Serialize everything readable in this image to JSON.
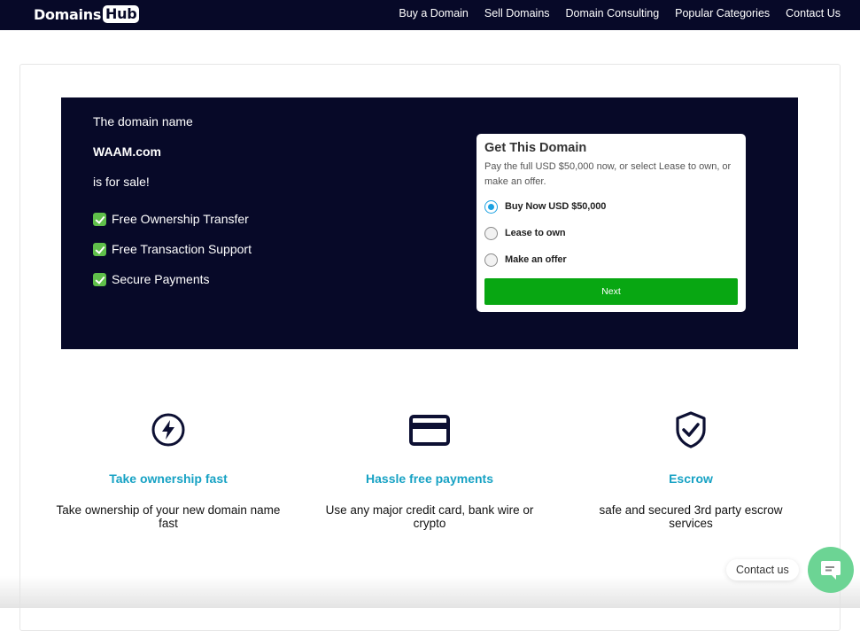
{
  "header": {
    "logo_main": "Domains",
    "logo_badge": "Hub",
    "nav": [
      "Buy a Domain",
      "Sell Domains",
      "Domain Consulting",
      "Popular Categories",
      "Contact Us"
    ]
  },
  "hero": {
    "intro": "The domain name",
    "domain": "WAAM.com",
    "status": "is for sale!",
    "features": [
      "Free Ownership Transfer",
      "Free Transaction Support",
      "Secure Payments"
    ]
  },
  "buy_box": {
    "title": "Get This Domain",
    "description": "Pay the full USD $50,000 now, or select Lease to own, or make an offer.",
    "options": [
      {
        "label": "Buy Now USD $50,000",
        "selected": true
      },
      {
        "label": "Lease to own",
        "selected": false
      },
      {
        "label": "Make an offer",
        "selected": false
      }
    ],
    "next_label": "Next"
  },
  "features": [
    {
      "icon": "lightning-icon",
      "title": "Take ownership fast",
      "description": "Take ownership of your new domain name fast"
    },
    {
      "icon": "credit-card-icon",
      "title": "Hassle free payments",
      "description": "Use any major credit card, bank wire or crypto"
    },
    {
      "icon": "shield-check-icon",
      "title": "Escrow",
      "description": "safe and secured 3rd party escrow services"
    }
  ],
  "chat": {
    "label": "Contact us"
  },
  "colors": {
    "navy": "#070928",
    "accent_teal": "#17a2c4",
    "next_green": "#08a712",
    "chat_green": "#6cd494",
    "radio_blue": "#1ba1e2"
  }
}
